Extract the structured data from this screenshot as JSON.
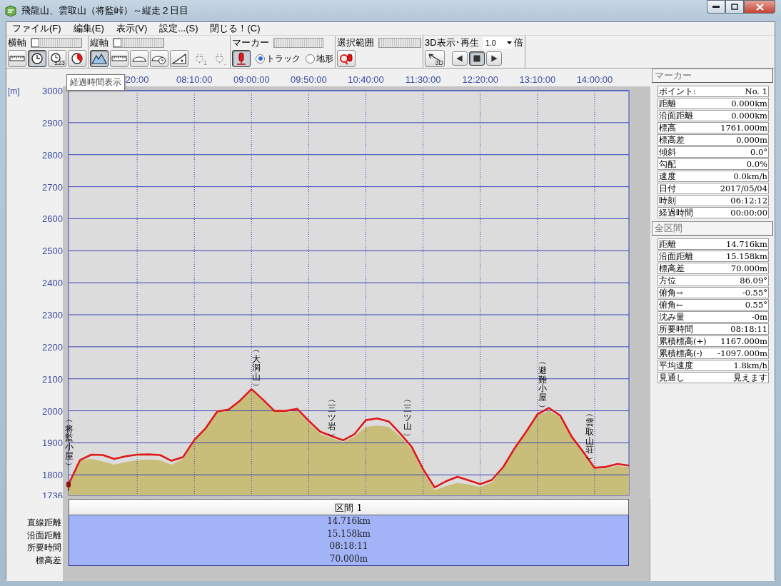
{
  "window": {
    "title": "飛龍山、雲取山（将監峠）～縦走２日目"
  },
  "menu": [
    "ファイル(F)",
    "編集(E)",
    "表示(V)",
    "設定...(S)",
    "閉じる！(C)"
  ],
  "toolbar": {
    "horizontal_axis": {
      "label": "横軸",
      "level": 0,
      "buttons": [
        {
          "kind": "ruler",
          "selected": false
        },
        {
          "kind": "clock",
          "selected": true
        },
        {
          "kind": "counter",
          "label": "123",
          "selected": false
        },
        {
          "kind": "pie",
          "selected": false
        }
      ]
    },
    "vertical_axis": {
      "label": "縦軸",
      "level": 0,
      "buttons": [
        {
          "kind": "mountain",
          "selected": true,
          "disabled": false
        },
        {
          "kind": "ruler",
          "selected": false,
          "disabled": false
        },
        {
          "kind": "arch",
          "selected": false,
          "disabled": false
        },
        {
          "kind": "gauge",
          "selected": false,
          "disabled": false
        },
        {
          "kind": "slope",
          "selected": false,
          "disabled": false
        },
        {
          "kind": "plug",
          "label": "1",
          "selected": false,
          "disabled": true
        },
        {
          "kind": "plug",
          "label": "..",
          "selected": false,
          "disabled": true
        }
      ]
    },
    "marker": {
      "label": "マーカー",
      "pin_selected": true,
      "radios": [
        {
          "label": "トラック",
          "selected": true
        },
        {
          "label": "地形",
          "selected": false
        }
      ]
    },
    "selection_range": {
      "label": "選択範囲"
    },
    "playback": {
      "label": "3D表示･再生",
      "speed": "1.0",
      "unit": "倍",
      "buttons": [
        {
          "kind": "perspective",
          "label": "3D",
          "selected": false
        },
        {
          "kind": "prev",
          "selected": false
        },
        {
          "kind": "stop",
          "selected": true
        },
        {
          "kind": "next",
          "selected": false
        }
      ]
    }
  },
  "tooltip": "経過時間表示",
  "chart": {
    "chart_data": {
      "type": "area",
      "grid": true,
      "ylabel": "[m]",
      "ylim": [
        1736,
        3000
      ],
      "categories": [
        null,
        null,
        null,
        null,
        null,
        null,
        "20:00",
        null,
        null,
        null,
        null,
        "08:10:00",
        null,
        null,
        null,
        null,
        "09:00:00",
        null,
        null,
        null,
        null,
        "09:50:00",
        null,
        null,
        null,
        null,
        "10:40:00",
        null,
        null,
        null,
        null,
        "11:30:00",
        null,
        null,
        null,
        null,
        "12:20:00",
        null,
        null,
        null,
        null,
        "13:10:00",
        null,
        null,
        null,
        null,
        "14:00:00",
        null,
        null,
        null
      ],
      "series": [
        {
          "color": "#c8bd79",
          "values": [
            1768,
            1846,
            1850,
            1842,
            1832,
            1840,
            1845,
            1848,
            1846,
            1832,
            1850,
            1905,
            1944,
            1996,
            2002,
            2030,
            2064,
            2030,
            1998,
            1996,
            2000,
            1962,
            1928,
            1915,
            1902,
            1920,
            1950,
            1954,
            1950,
            1920,
            1880,
            1810,
            1752,
            1765,
            1775,
            1770,
            1762,
            1776,
            1820,
            1880,
            1930,
            1985,
            2000,
            1980,
            1915,
            1868,
            1818,
            1820,
            1828,
            1824
          ]
        },
        {
          "type": "line",
          "color": "#e01818",
          "values": [
            1770,
            1846,
            1863,
            1862,
            1850,
            1858,
            1863,
            1864,
            1862,
            1844,
            1855,
            1909,
            1946,
            1998,
            2004,
            2032,
            2068,
            2035,
            2000,
            2000,
            2006,
            1969,
            1935,
            1921,
            1908,
            1927,
            1971,
            1976,
            1967,
            1929,
            1888,
            1818,
            1761,
            1780,
            1794,
            1783,
            1771,
            1784,
            1824,
            1883,
            1934,
            1989,
            2009,
            1985,
            1919,
            1872,
            1822,
            1825,
            1834,
            1829
          ]
        }
      ],
      "yticks": [
        1736,
        1800,
        1900,
        2000,
        2100,
        2200,
        2300,
        2400,
        2500,
        2600,
        2700,
        2800,
        2900,
        3000
      ],
      "annotations": [
        "︵将監小屋︶",
        "︵大洞山︶",
        "︵三ツ岩︶",
        "︵三ツ山︶",
        "︵避難小屋︶",
        "︵雲取山荘︶"
      ]
    }
  },
  "section_table": {
    "header": "区間 1",
    "rows": [
      {
        "label": "直線距離",
        "value": "14.716km"
      },
      {
        "label": "沿面距離",
        "value": "15.158km"
      },
      {
        "label": "所要時間",
        "value": "08:18:11"
      },
      {
        "label": "標高差",
        "value": "70.000m"
      }
    ]
  },
  "marker_panel": {
    "title": "マーカー",
    "rows": [
      {
        "label": "ポイント:",
        "value": "No. 1"
      },
      {
        "label": "距離",
        "value": "0.000km"
      },
      {
        "label": "沿面距離",
        "value": "0.000km"
      },
      {
        "label": "標高",
        "value": "1761.000m"
      },
      {
        "label": "標高差",
        "value": "0.000m"
      },
      {
        "label": "傾斜",
        "value": "0.0°"
      },
      {
        "label": "勾配",
        "value": "0.0%"
      },
      {
        "label": "速度",
        "value": "0.0km/h"
      },
      {
        "label": "日付",
        "value": "2017/05/04"
      },
      {
        "label": "時刻",
        "value": "06:12:12"
      },
      {
        "label": "経過時間",
        "value": "00:00:00"
      }
    ]
  },
  "total_panel": {
    "title": "全区間",
    "rows": [
      {
        "label": "距離",
        "value": "14.716km"
      },
      {
        "label": "沿面距離",
        "value": "15.158km"
      },
      {
        "label": "標高差",
        "value": "70.000m"
      },
      {
        "label": "方位",
        "value": "86.09°"
      },
      {
        "label": "俯角→",
        "value": "-0.55°"
      },
      {
        "label": "俯角←",
        "value": "0.55°"
      },
      {
        "label": "沈み量",
        "value": "-0m"
      },
      {
        "label": "所要時間",
        "value": "08:18:11"
      },
      {
        "label": "累積標高(+)",
        "value": "1167.000m"
      },
      {
        "label": "累積標高(-)",
        "value": "-1097.000m"
      },
      {
        "label": "平均速度",
        "value": "1.8km/h"
      },
      {
        "label": "見通し",
        "value": "見えます"
      }
    ]
  }
}
